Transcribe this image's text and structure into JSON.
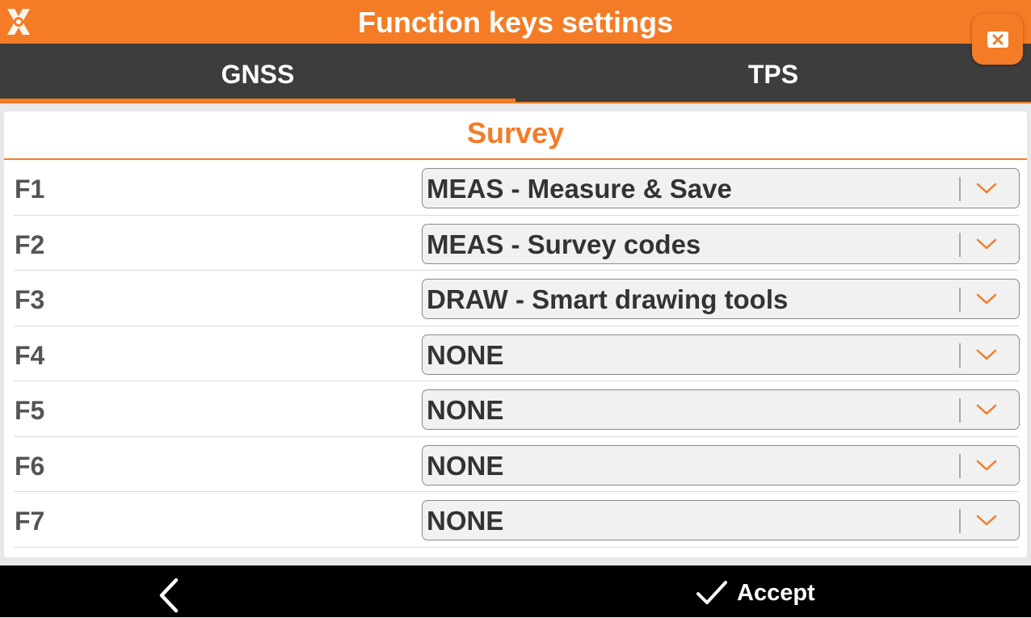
{
  "window": {
    "title": "Function keys settings"
  },
  "tabs": [
    {
      "label": "GNSS",
      "active": true
    },
    {
      "label": "TPS",
      "active": false
    }
  ],
  "section": {
    "title": "Survey"
  },
  "function_keys": [
    {
      "key": "F1",
      "value": "MEAS - Measure & Save"
    },
    {
      "key": "F2",
      "value": "MEAS - Survey codes"
    },
    {
      "key": "F3",
      "value": "DRAW - Smart drawing tools"
    },
    {
      "key": "F4",
      "value": "NONE"
    },
    {
      "key": "F5",
      "value": "NONE"
    },
    {
      "key": "F6",
      "value": "NONE"
    },
    {
      "key": "F7",
      "value": "NONE"
    }
  ],
  "bottom": {
    "accept_label": "Accept"
  },
  "icons": {
    "logo": "app-logo-icon",
    "close": "close-icon",
    "dropdown": "chevron-down-icon",
    "back": "chevron-left-icon",
    "accept": "checkmark-icon"
  },
  "colors": {
    "accent": "#f47c26",
    "tabbar": "#3d3d3d",
    "bottombar": "#000000"
  }
}
